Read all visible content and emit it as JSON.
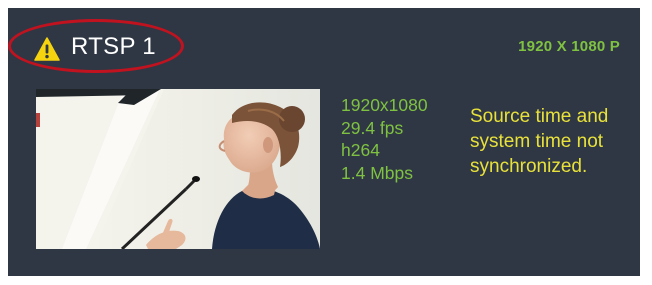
{
  "source": {
    "name": "RTSP 1",
    "status": "warning",
    "resolution_badge": "1920 X 1080 P",
    "stats": {
      "resolution": "1920x1080",
      "framerate": "29.4 fps",
      "codec": "h264",
      "bitrate": "1.4 Mbps"
    },
    "warning_message": "Source time and system time not synchronized."
  },
  "icons": {
    "status": "warning-triangle-icon"
  },
  "colors": {
    "card_background": "#2f3744",
    "stats_text": "#7fc241",
    "warning_text": "#e8e13a",
    "warning_icon": "#f5d40f",
    "highlight": "#c1121f"
  }
}
